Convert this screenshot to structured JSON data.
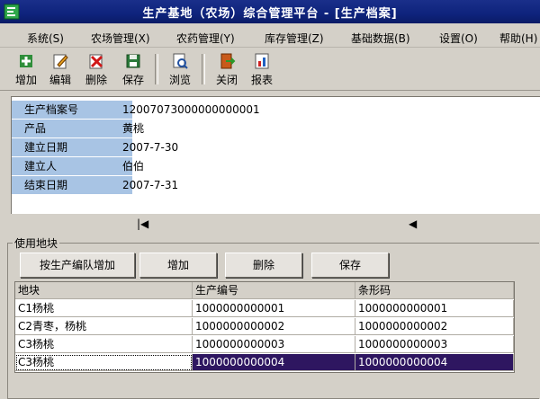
{
  "window": {
    "title": "生产基地（农场）综合管理平台 - [生产档案]"
  },
  "menu": [
    "系统(S)",
    "农场管理(X)",
    "农药管理(Y)",
    "库存管理(Z)",
    "基础数据(B)",
    "设置(O)",
    "帮助(H)"
  ],
  "toolbar": {
    "add": "增加",
    "edit": "编辑",
    "delete": "删除",
    "save": "保存",
    "browse": "浏览",
    "close": "关闭",
    "report": "报表"
  },
  "form": {
    "fields": [
      {
        "label": "生产档案号",
        "value": "12007073000000000001"
      },
      {
        "label": "产品",
        "value": "黄桃"
      },
      {
        "label": "建立日期",
        "value": "2007-7-30"
      },
      {
        "label": "建立人",
        "value": "伯伯"
      },
      {
        "label": "结束日期",
        "value": "2007-7-31"
      }
    ]
  },
  "navigator": {
    "first": "|◀",
    "prev": "◀"
  },
  "plots": {
    "group_title": "使用地块",
    "buttons": {
      "add_by_team": "按生产编队增加",
      "add": "增加",
      "delete": "删除",
      "save": "保存"
    },
    "columns": [
      "地块",
      "生产编号",
      "条形码"
    ],
    "rows": [
      [
        "C1杨桃",
        "1000000000001",
        "1000000000001"
      ],
      [
        "C2青枣，杨桃",
        "1000000000002",
        "1000000000002"
      ],
      [
        "C3杨桃",
        "1000000000003",
        "1000000000003"
      ],
      [
        "C3杨桃",
        "1000000000004",
        "1000000000004"
      ]
    ],
    "selected_row": 3
  },
  "colors": {
    "titlebar": "#0e237c",
    "label_bg": "#a8c4e4",
    "selection": "#2e1660"
  }
}
